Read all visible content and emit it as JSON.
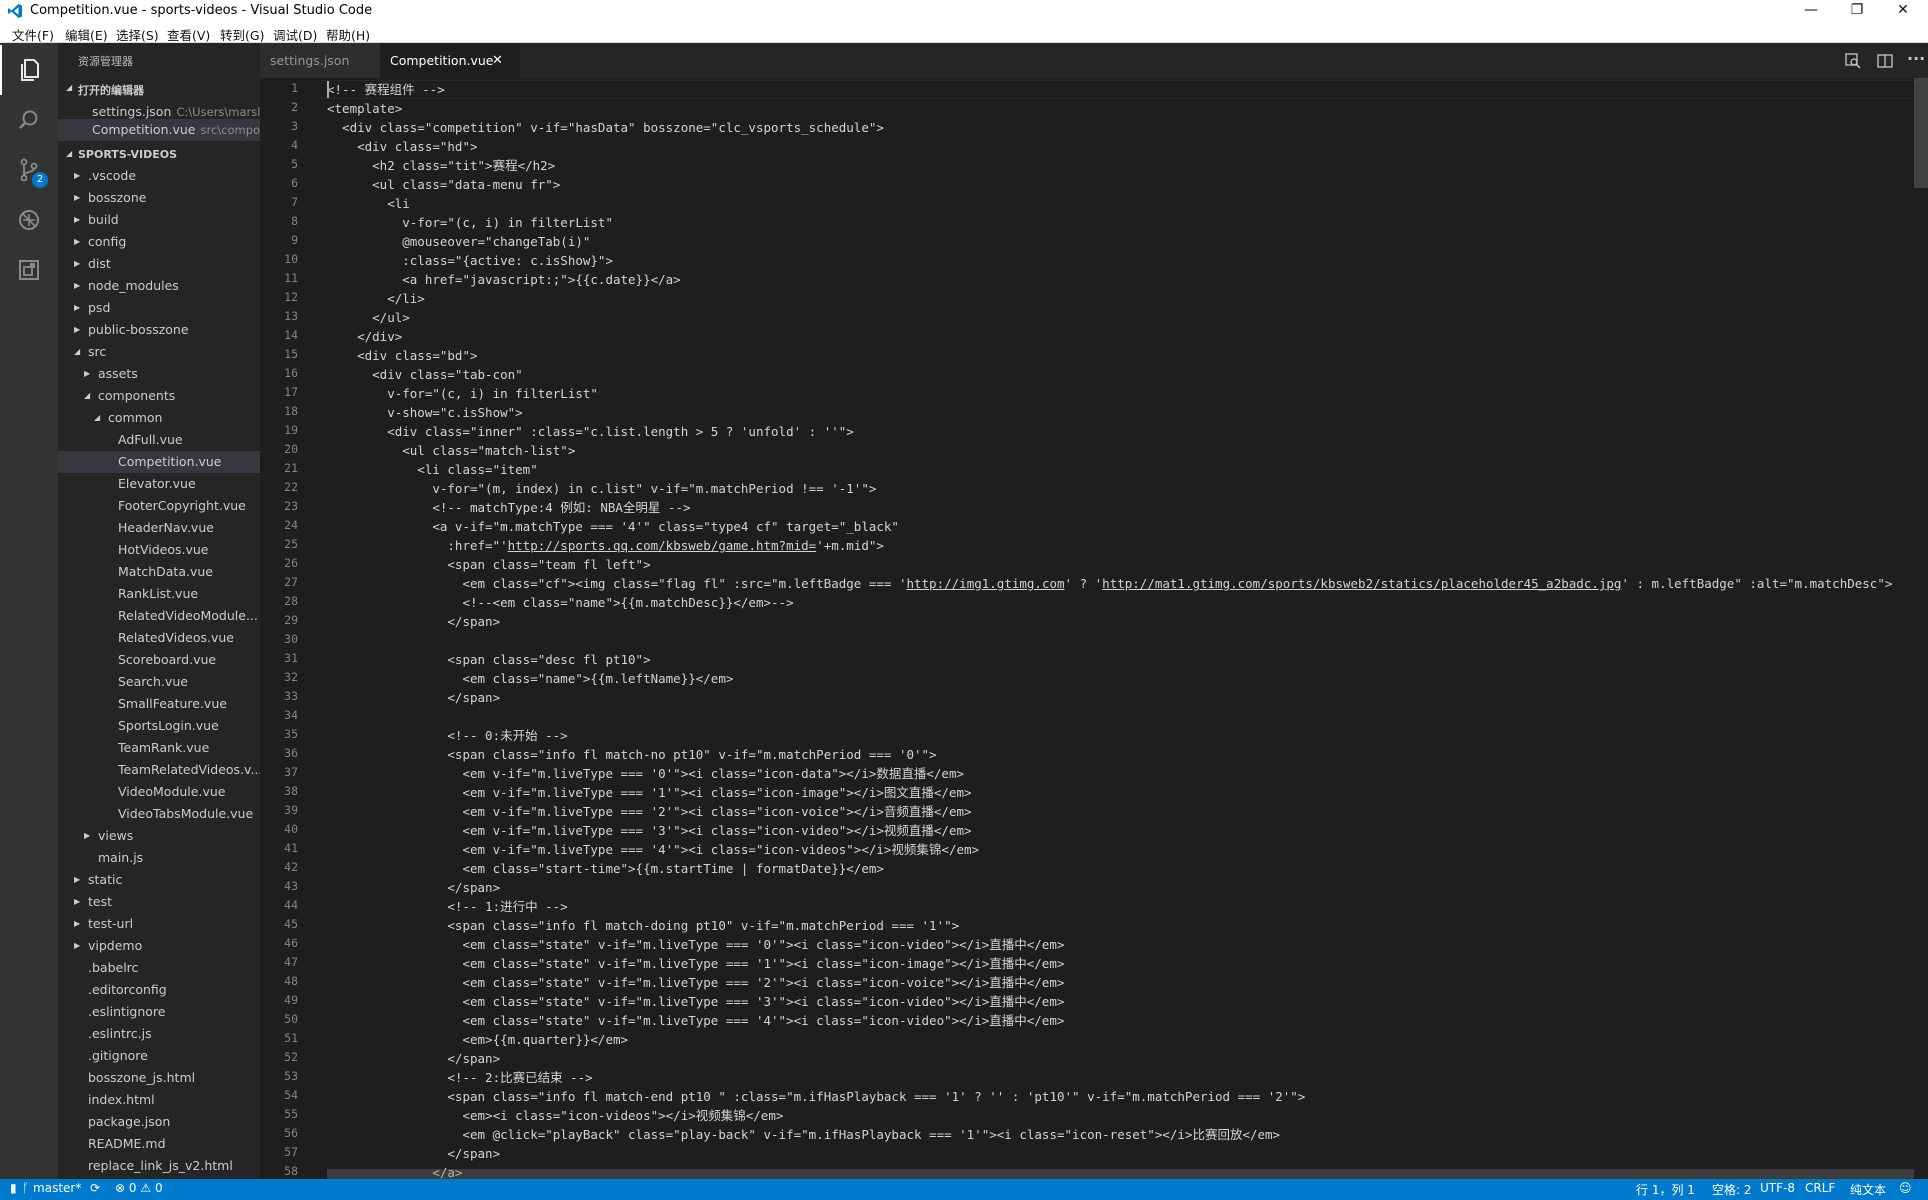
{
  "window": {
    "title": "Competition.vue - sports-videos - Visual Studio Code",
    "minimize": "—",
    "restore": "❐",
    "close": "✕"
  },
  "menu": [
    "文件(F)",
    "编辑(E)",
    "选择(S)",
    "查看(V)",
    "转到(G)",
    "调试(D)",
    "帮助(H)"
  ],
  "activity": {
    "icons": [
      "explorer-icon",
      "search-icon",
      "source-control-icon",
      "debug-icon",
      "extensions-icon"
    ],
    "scm_badge": "2"
  },
  "sidebar": {
    "title": "资源管理器",
    "open_editors_label": "打开的编辑器",
    "open_editors": [
      {
        "name": "settings.json",
        "path": "C:\\Users\\marsli..."
      },
      {
        "name": "Competition.vue",
        "path": "src\\compo..."
      }
    ],
    "project_label": "SPORTS-VIDEOS",
    "tree": [
      {
        "label": ".vscode",
        "depth": 0,
        "folder": true,
        "open": false
      },
      {
        "label": "bosszone",
        "depth": 0,
        "folder": true,
        "open": false
      },
      {
        "label": "build",
        "depth": 0,
        "folder": true,
        "open": false
      },
      {
        "label": "config",
        "depth": 0,
        "folder": true,
        "open": false
      },
      {
        "label": "dist",
        "depth": 0,
        "folder": true,
        "open": false
      },
      {
        "label": "node_modules",
        "depth": 0,
        "folder": true,
        "open": false
      },
      {
        "label": "psd",
        "depth": 0,
        "folder": true,
        "open": false
      },
      {
        "label": "public-bosszone",
        "depth": 0,
        "folder": true,
        "open": false
      },
      {
        "label": "src",
        "depth": 0,
        "folder": true,
        "open": true
      },
      {
        "label": "assets",
        "depth": 1,
        "folder": true,
        "open": false
      },
      {
        "label": "components",
        "depth": 1,
        "folder": true,
        "open": true
      },
      {
        "label": "common",
        "depth": 2,
        "folder": true,
        "open": true
      },
      {
        "label": "AdFull.vue",
        "depth": 3,
        "folder": false
      },
      {
        "label": "Competition.vue",
        "depth": 3,
        "folder": false,
        "selected": true
      },
      {
        "label": "Elevator.vue",
        "depth": 3,
        "folder": false
      },
      {
        "label": "FooterCopyright.vue",
        "depth": 3,
        "folder": false
      },
      {
        "label": "HeaderNav.vue",
        "depth": 3,
        "folder": false
      },
      {
        "label": "HotVideos.vue",
        "depth": 3,
        "folder": false
      },
      {
        "label": "MatchData.vue",
        "depth": 3,
        "folder": false
      },
      {
        "label": "RankList.vue",
        "depth": 3,
        "folder": false
      },
      {
        "label": "RelatedVideoModule...",
        "depth": 3,
        "folder": false
      },
      {
        "label": "RelatedVideos.vue",
        "depth": 3,
        "folder": false
      },
      {
        "label": "Scoreboard.vue",
        "depth": 3,
        "folder": false
      },
      {
        "label": "Search.vue",
        "depth": 3,
        "folder": false
      },
      {
        "label": "SmallFeature.vue",
        "depth": 3,
        "folder": false
      },
      {
        "label": "SportsLogin.vue",
        "depth": 3,
        "folder": false
      },
      {
        "label": "TeamRank.vue",
        "depth": 3,
        "folder": false
      },
      {
        "label": "TeamRelatedVideos.v...",
        "depth": 3,
        "folder": false
      },
      {
        "label": "VideoModule.vue",
        "depth": 3,
        "folder": false
      },
      {
        "label": "VideoTabsModule.vue",
        "depth": 3,
        "folder": false
      },
      {
        "label": "views",
        "depth": 1,
        "folder": true,
        "open": false
      },
      {
        "label": "main.js",
        "depth": 1,
        "folder": false
      },
      {
        "label": "static",
        "depth": 0,
        "folder": true,
        "open": false
      },
      {
        "label": "test",
        "depth": 0,
        "folder": true,
        "open": false
      },
      {
        "label": "test-url",
        "depth": 0,
        "folder": true,
        "open": false
      },
      {
        "label": "vipdemo",
        "depth": 0,
        "folder": true,
        "open": false
      },
      {
        "label": ".babelrc",
        "depth": 0,
        "folder": false
      },
      {
        "label": ".editorconfig",
        "depth": 0,
        "folder": false
      },
      {
        "label": ".eslintignore",
        "depth": 0,
        "folder": false
      },
      {
        "label": ".eslintrc.js",
        "depth": 0,
        "folder": false
      },
      {
        "label": ".gitignore",
        "depth": 0,
        "folder": false
      },
      {
        "label": "bosszone_js.html",
        "depth": 0,
        "folder": false
      },
      {
        "label": "index.html",
        "depth": 0,
        "folder": false
      },
      {
        "label": "package.json",
        "depth": 0,
        "folder": false
      },
      {
        "label": "README.md",
        "depth": 0,
        "folder": false
      },
      {
        "label": "replace_link_js_v2.html",
        "depth": 0,
        "folder": false
      }
    ]
  },
  "tabs": [
    {
      "label": "settings.json",
      "active": false
    },
    {
      "label": "Competition.vue",
      "active": true,
      "close": "✕"
    }
  ],
  "editor": {
    "lines": [
      {
        "n": "1",
        "parts": [
          {
            "t": "<!-- 赛程组件 -->"
          }
        ]
      },
      {
        "n": "2",
        "parts": [
          {
            "t": "<template>"
          }
        ]
      },
      {
        "n": "3",
        "parts": [
          {
            "t": "  <div class=\"competition\" v-if=\"hasData\" bosszone=\"clc_vsports_schedule\">"
          }
        ]
      },
      {
        "n": "4",
        "parts": [
          {
            "t": "    <div class=\"hd\">"
          }
        ]
      },
      {
        "n": "5",
        "parts": [
          {
            "t": "      <h2 class=\"tit\">赛程</h2>"
          }
        ]
      },
      {
        "n": "6",
        "parts": [
          {
            "t": "      <ul class=\"data-menu fr\">"
          }
        ]
      },
      {
        "n": "7",
        "parts": [
          {
            "t": "        <li"
          }
        ]
      },
      {
        "n": "8",
        "parts": [
          {
            "t": "          v-for=\"(c, i) in filterList\""
          }
        ]
      },
      {
        "n": "9",
        "parts": [
          {
            "t": "          @mouseover=\"changeTab(i)\""
          }
        ]
      },
      {
        "n": "10",
        "parts": [
          {
            "t": "          :class=\"{active: c.isShow}\">"
          }
        ]
      },
      {
        "n": "11",
        "parts": [
          {
            "t": "          <a href=\"javascript:;\">{{c.date}}</a>"
          }
        ]
      },
      {
        "n": "12",
        "parts": [
          {
            "t": "        </li>"
          }
        ]
      },
      {
        "n": "13",
        "parts": [
          {
            "t": "      </ul>"
          }
        ]
      },
      {
        "n": "14",
        "parts": [
          {
            "t": "    </div>"
          }
        ]
      },
      {
        "n": "15",
        "parts": [
          {
            "t": "    <div class=\"bd\">"
          }
        ]
      },
      {
        "n": "16",
        "parts": [
          {
            "t": "      <div class=\"tab-con\""
          }
        ]
      },
      {
        "n": "17",
        "parts": [
          {
            "t": "        v-for=\"(c, i) in filterList\""
          }
        ]
      },
      {
        "n": "18",
        "parts": [
          {
            "t": "        v-show=\"c.isShow\">"
          }
        ]
      },
      {
        "n": "19",
        "parts": [
          {
            "t": "        <div class=\"inner\" :class=\"c.list.length > 5 ? 'unfold' : ''\">"
          }
        ]
      },
      {
        "n": "20",
        "parts": [
          {
            "t": "          <ul class=\"match-list\">"
          }
        ]
      },
      {
        "n": "21",
        "parts": [
          {
            "t": "            <li class=\"item\""
          }
        ]
      },
      {
        "n": "22",
        "parts": [
          {
            "t": "              v-for=\"(m, index) in c.list\" v-if=\"m.matchPeriod !== '-1'\">"
          }
        ]
      },
      {
        "n": "23",
        "parts": [
          {
            "t": "              <!-- matchType:4 例如: NBA全明星 -->"
          }
        ]
      },
      {
        "n": "24",
        "parts": [
          {
            "t": "              <a v-if=\"m.matchType === '4'\" class=\"type4 cf\" target=\"_black\""
          }
        ]
      },
      {
        "n": "25",
        "parts": [
          {
            "t": "                :href=\"'"
          },
          {
            "t": "http://sports.qq.com/kbsweb/game.htm?mid=",
            "u": true
          },
          {
            "t": "'+m.mid\">"
          }
        ]
      },
      {
        "n": "26",
        "parts": [
          {
            "t": "                <span class=\"team fl left\">"
          }
        ]
      },
      {
        "n": "27",
        "parts": [
          {
            "t": "                  <em class=\"cf\"><img class=\"flag fl\" :src=\"m.leftBadge === '"
          },
          {
            "t": "http://img1.gtimg.com",
            "u": true
          },
          {
            "t": "' ? '"
          },
          {
            "t": "http://mat1.gtimg.com/sports/kbsweb2/statics/placeholder45_a2badc.jpg",
            "u": true
          },
          {
            "t": "' : m.leftBadge\" :alt=\"m.matchDesc\">"
          }
        ]
      },
      {
        "n": "28",
        "parts": [
          {
            "t": "                  <!--<em class=\"name\">{{m.matchDesc}}</em>-->"
          }
        ]
      },
      {
        "n": "29",
        "parts": [
          {
            "t": "                </span>"
          }
        ]
      },
      {
        "n": "30",
        "parts": [
          {
            "t": ""
          }
        ]
      },
      {
        "n": "31",
        "parts": [
          {
            "t": "                <span class=\"desc fl pt10\">"
          }
        ]
      },
      {
        "n": "32",
        "parts": [
          {
            "t": "                  <em class=\"name\">{{m.leftName}}</em>"
          }
        ]
      },
      {
        "n": "33",
        "parts": [
          {
            "t": "                </span>"
          }
        ]
      },
      {
        "n": "34",
        "parts": [
          {
            "t": ""
          }
        ]
      },
      {
        "n": "35",
        "parts": [
          {
            "t": "                <!-- 0:未开始 -->"
          }
        ]
      },
      {
        "n": "36",
        "parts": [
          {
            "t": "                <span class=\"info fl match-no pt10\" v-if=\"m.matchPeriod === '0'\">"
          }
        ]
      },
      {
        "n": "37",
        "parts": [
          {
            "t": "                  <em v-if=\"m.liveType === '0'\"><i class=\"icon-data\"></i>数据直播</em>"
          }
        ]
      },
      {
        "n": "38",
        "parts": [
          {
            "t": "                  <em v-if=\"m.liveType === '1'\"><i class=\"icon-image\"></i>图文直播</em>"
          }
        ]
      },
      {
        "n": "39",
        "parts": [
          {
            "t": "                  <em v-if=\"m.liveType === '2'\"><i class=\"icon-voice\"></i>音频直播</em>"
          }
        ]
      },
      {
        "n": "40",
        "parts": [
          {
            "t": "                  <em v-if=\"m.liveType === '3'\"><i class=\"icon-video\"></i>视频直播</em>"
          }
        ]
      },
      {
        "n": "41",
        "parts": [
          {
            "t": "                  <em v-if=\"m.liveType === '4'\"><i class=\"icon-videos\"></i>视频集锦</em>"
          }
        ]
      },
      {
        "n": "42",
        "parts": [
          {
            "t": "                  <em class=\"start-time\">{{m.startTime | formatDate}}</em>"
          }
        ]
      },
      {
        "n": "43",
        "parts": [
          {
            "t": "                </span>"
          }
        ]
      },
      {
        "n": "44",
        "parts": [
          {
            "t": "                <!-- 1:进行中 -->"
          }
        ]
      },
      {
        "n": "45",
        "parts": [
          {
            "t": "                <span class=\"info fl match-doing pt10\" v-if=\"m.matchPeriod === '1'\">"
          }
        ]
      },
      {
        "n": "46",
        "parts": [
          {
            "t": "                  <em class=\"state\" v-if=\"m.liveType === '0'\"><i class=\"icon-video\"></i>直播中</em>"
          }
        ]
      },
      {
        "n": "47",
        "parts": [
          {
            "t": "                  <em class=\"state\" v-if=\"m.liveType === '1'\"><i class=\"icon-image\"></i>直播中</em>"
          }
        ]
      },
      {
        "n": "48",
        "parts": [
          {
            "t": "                  <em class=\"state\" v-if=\"m.liveType === '2'\"><i class=\"icon-voice\"></i>直播中</em>"
          }
        ]
      },
      {
        "n": "49",
        "parts": [
          {
            "t": "                  <em class=\"state\" v-if=\"m.liveType === '3'\"><i class=\"icon-video\"></i>直播中</em>"
          }
        ]
      },
      {
        "n": "50",
        "parts": [
          {
            "t": "                  <em class=\"state\" v-if=\"m.liveType === '4'\"><i class=\"icon-video\"></i>直播中</em>"
          }
        ]
      },
      {
        "n": "51",
        "parts": [
          {
            "t": "                  <em>{{m.quarter}}</em>"
          }
        ]
      },
      {
        "n": "52",
        "parts": [
          {
            "t": "                </span>"
          }
        ]
      },
      {
        "n": "53",
        "parts": [
          {
            "t": "                <!-- 2:比赛已结束 -->"
          }
        ]
      },
      {
        "n": "54",
        "parts": [
          {
            "t": "                <span class=\"info fl match-end pt10 \" :class=\"m.ifHasPlayback === '1' ? '' : 'pt10'\" v-if=\"m.matchPeriod === '2'\">"
          }
        ]
      },
      {
        "n": "55",
        "parts": [
          {
            "t": "                  <em><i class=\"icon-videos\"></i>视频集锦</em>"
          }
        ]
      },
      {
        "n": "56",
        "parts": [
          {
            "t": "                  <em @click=\"playBack\" class=\"play-back\" v-if=\"m.ifHasPlayback === '1'\"><i class=\"icon-reset\"></i>比赛回放</em>"
          }
        ]
      },
      {
        "n": "57",
        "parts": [
          {
            "t": "                </span>"
          }
        ]
      },
      {
        "n": "58",
        "parts": [
          {
            "t": "              </a>"
          }
        ]
      }
    ]
  },
  "status": {
    "branch": "master*",
    "sync_icon": "sync-icon",
    "errors": "0",
    "warnings": "0",
    "position": "行 1，列 1",
    "spaces": "空格: 2",
    "encoding": "UTF-8",
    "eol": "CRLF",
    "language": "纯文本",
    "feedback_icon": "smiley-icon"
  },
  "colors": {
    "accent": "#007acc",
    "editor_bg": "#1e1e1e",
    "sidebar_bg": "#252526",
    "activity_bg": "#333333"
  }
}
